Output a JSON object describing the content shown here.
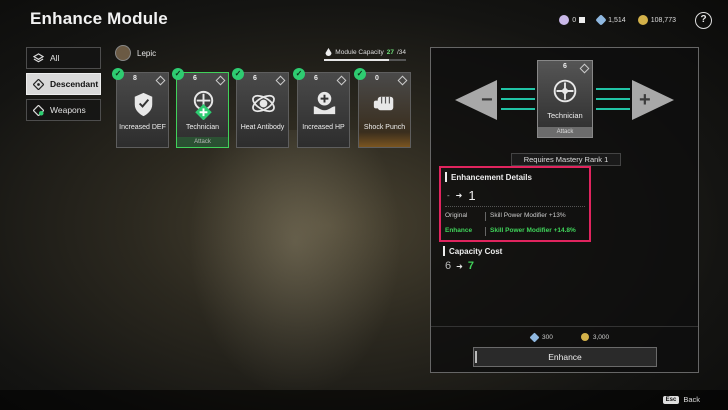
{
  "header": {
    "title": "Enhance Module",
    "currencies": [
      {
        "icon": "kuiper-icon",
        "value": "0",
        "color": "#c9b8e8"
      },
      {
        "icon": "crystal-icon",
        "value": "1,514",
        "color": "#8fb8e0"
      },
      {
        "icon": "gold-coin-icon",
        "value": "108,773",
        "color": "#d4b24a"
      }
    ],
    "help_label": "?"
  },
  "sidebar": {
    "items": [
      {
        "label": "All",
        "icon": "layers-icon",
        "active": false
      },
      {
        "label": "Descendant",
        "icon": "descendant-icon",
        "active": true
      },
      {
        "label": "Weapons",
        "icon": "weapon-icon",
        "active": false
      }
    ]
  },
  "list_header": {
    "character": "Lepic",
    "capacity_label": "Module Capacity",
    "capacity_current": "27",
    "capacity_max": "/34",
    "capacity_fraction": 0.79
  },
  "modules": [
    {
      "label": "Increased DEF",
      "cost": "8",
      "icon": "shield-icon",
      "type": "",
      "selected": false
    },
    {
      "label": "Technician",
      "cost": "6",
      "icon": "technician-icon",
      "type": "Attack",
      "selected": true
    },
    {
      "label": "Heat Antibody",
      "cost": "6",
      "icon": "heat-antibody-icon",
      "type": "",
      "selected": false
    },
    {
      "label": "Increased HP",
      "cost": "6",
      "icon": "hp-hand-icon",
      "type": "",
      "selected": false
    },
    {
      "label": "Shock Punch",
      "cost": "0",
      "icon": "fist-icon",
      "type": "",
      "selected": false
    }
  ],
  "preview": {
    "label": "Technician",
    "type": "Attack",
    "cost": "6",
    "icon": "technician-icon",
    "requirement": "Requires Mastery Rank 1"
  },
  "details": {
    "title": "Enhancement Details",
    "level_from": "-",
    "level_to": "1",
    "original_label": "Original",
    "original_value": "Skill Power Modifier +13%",
    "enhance_label": "Enhance",
    "enhance_value": "Skill Power Modifier +14.8%"
  },
  "capacity": {
    "title": "Capacity Cost",
    "from": "6",
    "to": "7"
  },
  "costs": [
    {
      "icon": "crystal-icon",
      "value": "300"
    },
    {
      "icon": "gold-coin-icon",
      "value": "3,000"
    }
  ],
  "actions": {
    "enhance_label": "Enhance",
    "back_key": "Esc",
    "back_label": "Back"
  },
  "colors": {
    "accent_green": "#41d15a",
    "highlight_red": "#e0245e"
  }
}
